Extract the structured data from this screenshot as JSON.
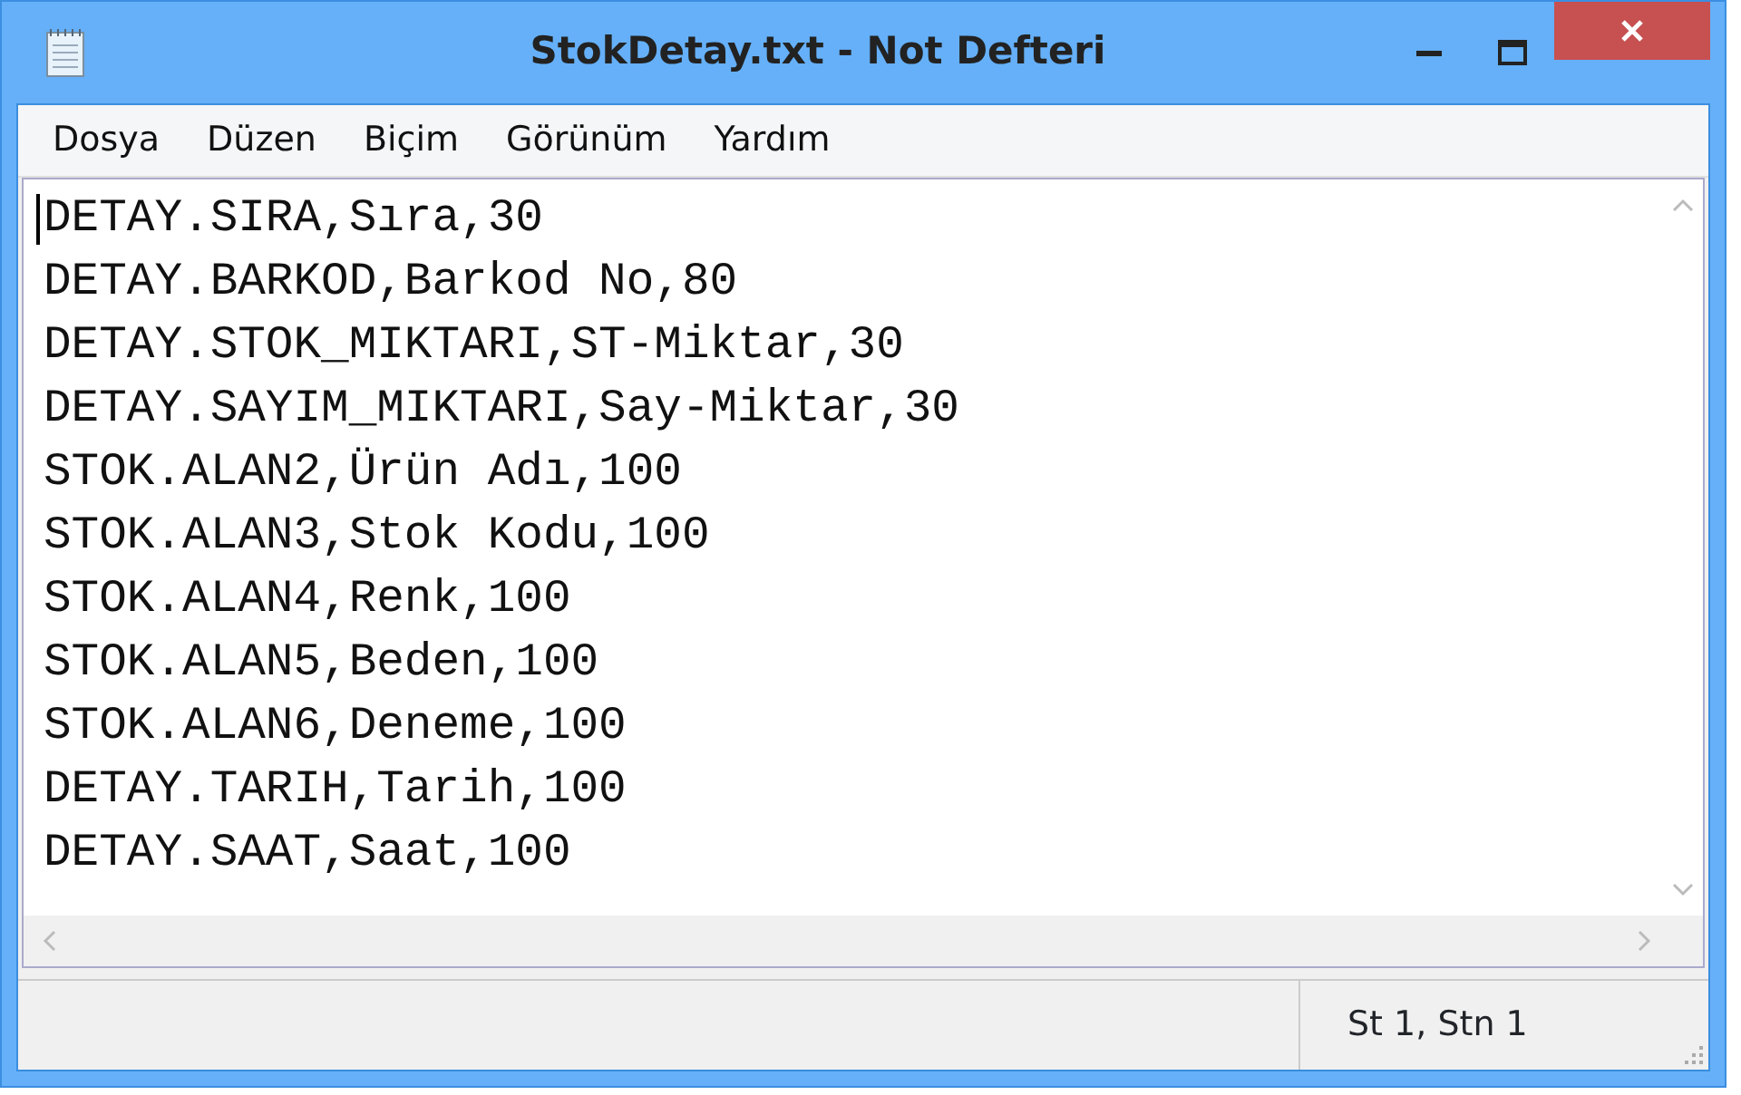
{
  "window": {
    "title": "StokDetay.txt - Not Defteri"
  },
  "menu": [
    "Dosya",
    "Düzen",
    "Biçim",
    "Görünüm",
    "Yardım"
  ],
  "editor": {
    "lines": [
      "DETAY.SIRA,Sıra,30",
      "DETAY.BARKOD,Barkod No,80",
      "DETAY.STOK_MIKTARI,ST-Miktar,30",
      "DETAY.SAYIM_MIKTARI,Say-Miktar,30",
      "STOK.ALAN2,Ürün Adı,100",
      "STOK.ALAN3,Stok Kodu,100",
      "STOK.ALAN4,Renk,100",
      "STOK.ALAN5,Beden,100",
      "STOK.ALAN6,Deneme,100",
      "DETAY.TARIH,Tarih,100",
      "DETAY.SAAT,Saat,100"
    ]
  },
  "status_bar": {
    "position": "St 1, Stn 1"
  }
}
